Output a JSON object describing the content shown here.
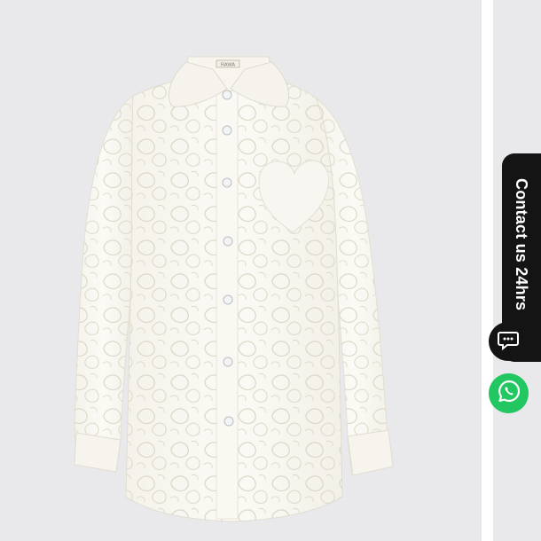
{
  "product": {
    "image_alt": "White sheer lace button-up shirt with heart pocket",
    "label_text": "RAWA"
  },
  "contact": {
    "label": "Contact us 24hrs",
    "chat_icon": "chat-bubble-icon",
    "whatsapp_icon": "whatsapp-icon"
  },
  "colors": {
    "background": "#e9e9eb",
    "tab": "#141414",
    "whatsapp": "#23c761"
  }
}
